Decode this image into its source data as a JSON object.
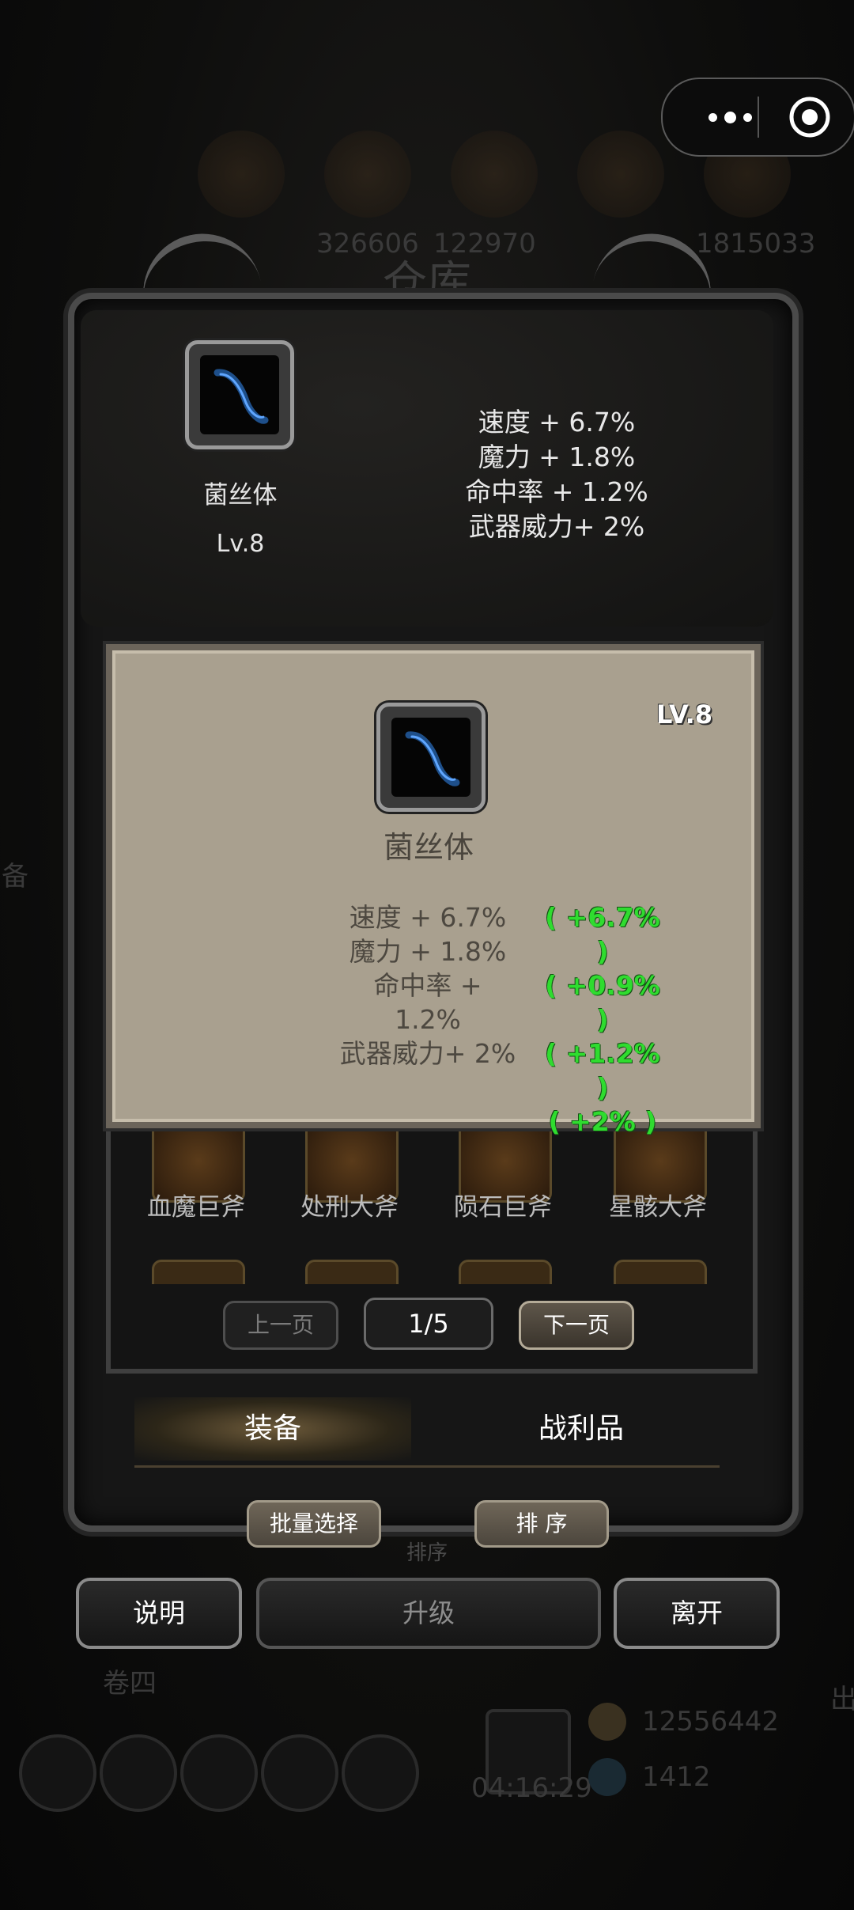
{
  "background": {
    "resource_values": [
      "326606",
      "122970",
      "1815033"
    ],
    "side_label": "备",
    "bottom_label": "卷四",
    "timer": "04:16:29",
    "currency_1": "12556442",
    "currency_2": "1412",
    "edge_label": "出",
    "sort_label": "排序"
  },
  "warehouse_title": "仓库",
  "selected_item": {
    "name": "菌丝体",
    "level": "Lv.8",
    "icon": "curved-blade-icon",
    "stats": [
      "速度 + 6.7%",
      "魔力 + 1.8%",
      "命中率 + 1.2%",
      "武器威力+ 2%"
    ]
  },
  "detail_card": {
    "level": "LV.8",
    "name": "菌丝体",
    "stats": [
      "速度 + 6.7%",
      "魔力 + 1.8%",
      "命中率 + 1.2%",
      "武器威力+ 2%"
    ],
    "bonuses": [
      "( +6.7% )",
      "( +0.9% )",
      "( +1.2% )",
      "( +2% )"
    ]
  },
  "equipment_list": {
    "items": [
      {
        "name": "血魔巨斧",
        "icon": "blood-axe-icon"
      },
      {
        "name": "处刑大斧",
        "icon": "execution-axe-icon"
      },
      {
        "name": "陨石巨斧",
        "icon": "meteor-axe-icon"
      },
      {
        "name": "星骸大斧",
        "icon": "star-axe-icon"
      }
    ]
  },
  "pagination": {
    "prev_label": "上一页",
    "page_indicator": "1/5",
    "next_label": "下一页"
  },
  "tabs": [
    {
      "label": "装备",
      "active": true
    },
    {
      "label": "战利品",
      "active": false
    }
  ],
  "actions": {
    "batch_select": "批量选择",
    "sort": "排 序",
    "explain": "说明",
    "upgrade": "升级",
    "leave": "离开"
  },
  "colors": {
    "bonus_green": "#2fdc2f",
    "card_bg": "#a9a08f",
    "frame": "#4a4a4a"
  }
}
